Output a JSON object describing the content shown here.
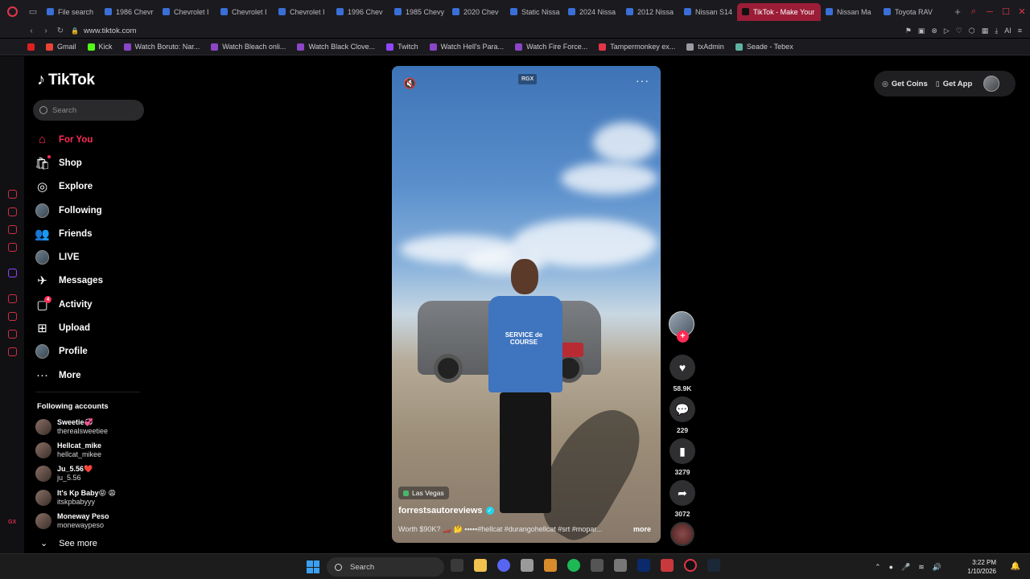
{
  "browser": {
    "tabs": [
      {
        "title": "File search",
        "active": false
      },
      {
        "title": "1986 Chevr",
        "active": false
      },
      {
        "title": "Chevrolet I",
        "active": false
      },
      {
        "title": "Chevrolet I",
        "active": false
      },
      {
        "title": "Chevrolet I",
        "active": false
      },
      {
        "title": "1996 Chev",
        "active": false
      },
      {
        "title": "1985 Chevy",
        "active": false
      },
      {
        "title": "2020 Chev",
        "active": false
      },
      {
        "title": "Static Nissa",
        "active": false
      },
      {
        "title": "2024 Nissa",
        "active": false
      },
      {
        "title": "2012 Nissa",
        "active": false
      },
      {
        "title": "Nissan S14",
        "active": false
      },
      {
        "title": "TikTok - Make Your",
        "active": true
      },
      {
        "title": "Nissan Ma",
        "active": false
      },
      {
        "title": "Toyota RAV",
        "active": false
      }
    ],
    "url": "www.tiktok.com",
    "ai_label": "AI",
    "bookmarks": [
      {
        "label": "Gmail",
        "color": "#ea4335"
      },
      {
        "label": "Kick",
        "color": "#53fc18"
      },
      {
        "label": "Watch Boruto: Nar...",
        "color": "#8b45c7"
      },
      {
        "label": "Watch Bleach onli...",
        "color": "#8b45c7"
      },
      {
        "label": "Watch Black Clove...",
        "color": "#8b45c7"
      },
      {
        "label": "Twitch",
        "color": "#9146ff"
      },
      {
        "label": "Watch Hell's Para...",
        "color": "#8b45c7"
      },
      {
        "label": "Watch Fire Force...",
        "color": "#8b45c7"
      },
      {
        "label": "Tampermonkey ex...",
        "color": "#e3354a"
      },
      {
        "label": "txAdmin",
        "color": "#9a9aa2"
      },
      {
        "label": "Seade - Tebex",
        "color": "#5fb3a0"
      }
    ]
  },
  "tiktok": {
    "logo": "TikTok",
    "search_placeholder": "Search",
    "nav": [
      {
        "label": "For You",
        "icon": "home-icon",
        "glyph": "⌂"
      },
      {
        "label": "Shop",
        "icon": "shop-icon",
        "glyph": "🛍"
      },
      {
        "label": "Explore",
        "icon": "explore-icon",
        "glyph": "◎"
      },
      {
        "label": "Following",
        "icon": "following-avatar",
        "glyph": ""
      },
      {
        "label": "Friends",
        "icon": "friends-icon",
        "glyph": "👥"
      },
      {
        "label": "LIVE",
        "icon": "live-avatar",
        "glyph": ""
      },
      {
        "label": "Messages",
        "icon": "messages-icon",
        "glyph": "✈"
      },
      {
        "label": "Activity",
        "icon": "activity-icon",
        "glyph": "▢"
      },
      {
        "label": "Upload",
        "icon": "upload-icon",
        "glyph": "⊞"
      },
      {
        "label": "Profile",
        "icon": "profile-avatar",
        "glyph": ""
      },
      {
        "label": "More",
        "icon": "more-icon",
        "glyph": "···"
      }
    ],
    "activity_badge": "4",
    "following_title": "Following accounts",
    "following": [
      {
        "display": "Sweetie💞",
        "user": "therealsweetiee"
      },
      {
        "display": "Hellcat_mike",
        "user": "hellcat_mikee"
      },
      {
        "display": "Ju_5.56❤️",
        "user": "ju_5.56"
      },
      {
        "display": "It's Kp Baby😝 😩",
        "user": "itskpbabyyy"
      },
      {
        "display": "Moneway Peso",
        "user": "monewaypeso"
      }
    ],
    "see_more": "See more",
    "top_right": {
      "get_coins": "Get Coins",
      "get_app": "Get App"
    },
    "video": {
      "overlay_tag": "RGX",
      "location": "Las Vegas",
      "author": "forrestsautoreviews",
      "caption": "Worth $90K? 🏎️ 🤔 ▪▪▪▪▪#hellcat #durangohellcat #srt #mopar...",
      "more_label": "more",
      "jersey_text": "SERVICE de COURSE"
    },
    "actions": {
      "likes": "58.9K",
      "comments": "229",
      "saves": "3279",
      "shares": "3072"
    }
  },
  "taskbar": {
    "search_label": "Search",
    "time": "3:22 PM",
    "date": "1/10/2026"
  }
}
